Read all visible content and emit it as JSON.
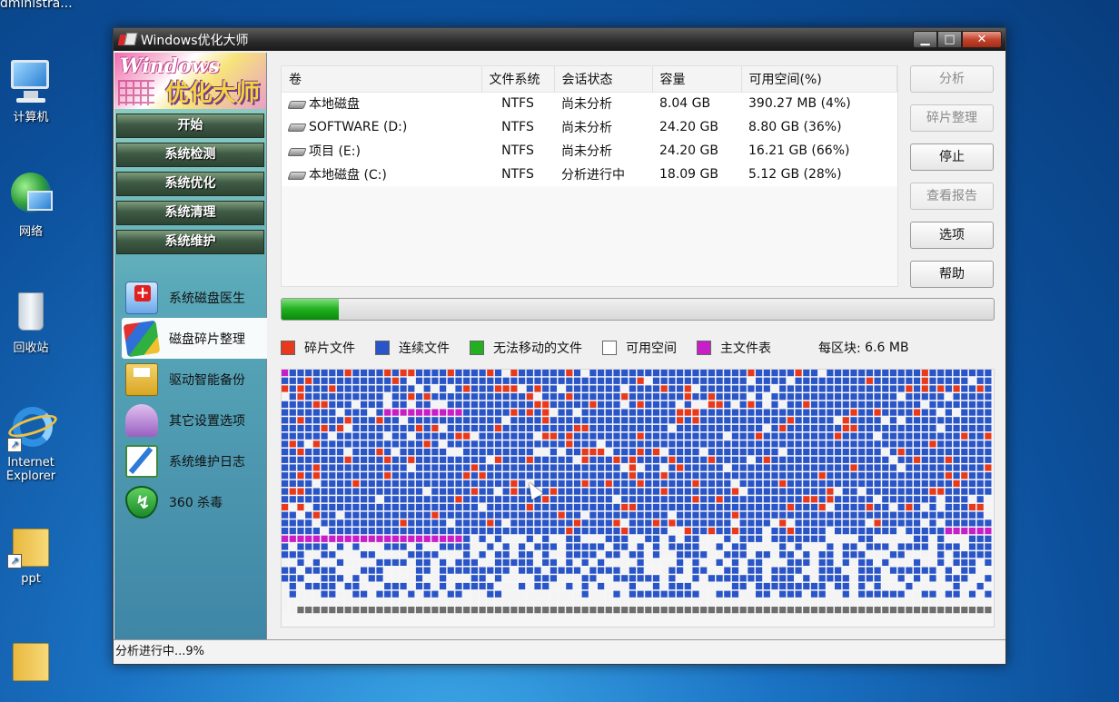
{
  "desktop": {
    "user_label": "dministra...",
    "icons": [
      {
        "label": "计算机"
      },
      {
        "label": "网络"
      },
      {
        "label": "回收站"
      },
      {
        "label": "Internet Explorer"
      },
      {
        "label": "ppt"
      }
    ]
  },
  "window": {
    "title": "Windows优化大师",
    "controls": {
      "minimize": "▁",
      "maximize": "□",
      "close": "✕"
    }
  },
  "logo": {
    "line1": "Windows",
    "line2": "优化大师"
  },
  "nav": {
    "buttons": [
      "开始",
      "系统检测",
      "系统优化",
      "系统清理",
      "系统维护"
    ],
    "subitems": [
      "系统磁盘医生",
      "磁盘碎片整理",
      "驱动智能备份",
      "其它设置选项",
      "系统维护日志",
      "360 杀毒"
    ]
  },
  "volumes": {
    "headers": [
      "卷",
      "文件系统",
      "会话状态",
      "容量",
      "可用空间(%)"
    ],
    "rows": [
      {
        "name": "本地磁盘",
        "fs": "NTFS",
        "status": "尚未分析",
        "capacity": "8.04 GB",
        "free": "390.27 MB (4%)"
      },
      {
        "name": "SOFTWARE (D:)",
        "fs": "NTFS",
        "status": "尚未分析",
        "capacity": "24.20 GB",
        "free": "8.80 GB (36%)"
      },
      {
        "name": "项目 (E:)",
        "fs": "NTFS",
        "status": "尚未分析",
        "capacity": "24.20 GB",
        "free": "16.21 GB (66%)"
      },
      {
        "name": "本地磁盘 (C:)",
        "fs": "NTFS",
        "status": "分析进行中",
        "capacity": "18.09 GB",
        "free": "5.12 GB (28%)"
      }
    ]
  },
  "buttons": {
    "analyze": "分析",
    "defrag": "碎片整理",
    "stop": "停止",
    "report": "查看报告",
    "options": "选项",
    "help": "帮助"
  },
  "progress": {
    "fraction": 0.08
  },
  "legend": {
    "items": [
      {
        "label": "碎片文件",
        "color": "#e8391c"
      },
      {
        "label": "连续文件",
        "color": "#2a55c8"
      },
      {
        "label": "无法移动的文件",
        "color": "#22b022"
      },
      {
        "label": "可用空间",
        "color": "#ffffff"
      },
      {
        "label": "主文件表",
        "color": "#c81ec8"
      }
    ],
    "block_label": "每区块:",
    "block_size": "6.6 MB"
  },
  "status": {
    "text": "分析进行中...9%"
  },
  "colors": {
    "fragment": "#e8391c",
    "contiguous": "#2a55c8",
    "free": "#f4f4f4",
    "mft": "#c81ec8",
    "system": "#6e6e6e"
  }
}
